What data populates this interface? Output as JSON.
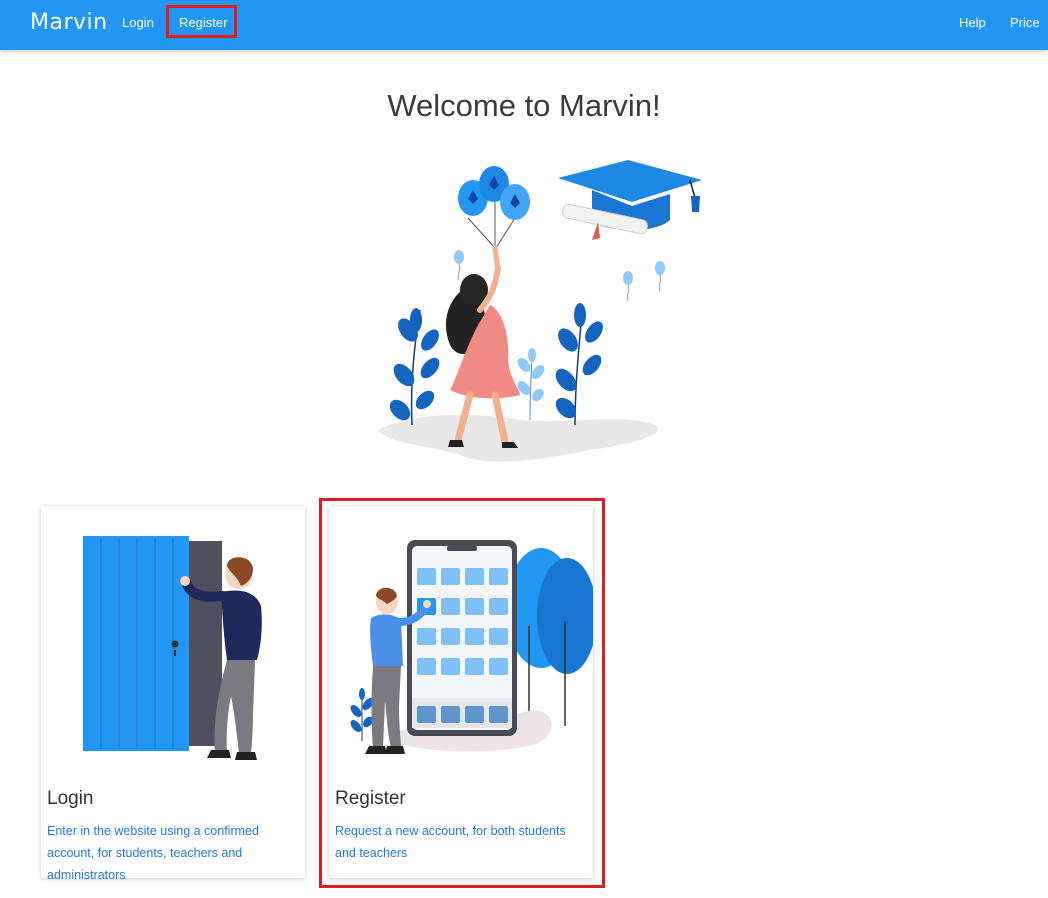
{
  "navbar": {
    "brand": "Marvin",
    "login": "Login",
    "register": "Register",
    "help": "Help",
    "price": "Price",
    "color": "#2196f3"
  },
  "main": {
    "welcome": "Welcome to Marvin!",
    "hero_image": "graduate-balloons-illustration"
  },
  "cards": [
    {
      "image": "door-person-illustration",
      "title": "Login",
      "text": "Enter in the website using a confirmed account, for students, teachers and administrators"
    },
    {
      "image": "phone-register-illustration",
      "title": "Register",
      "text": "Request a new account, for both students and teachers"
    }
  ],
  "highlight_color": "#e01c1c",
  "link_color": "#1e7bd6"
}
